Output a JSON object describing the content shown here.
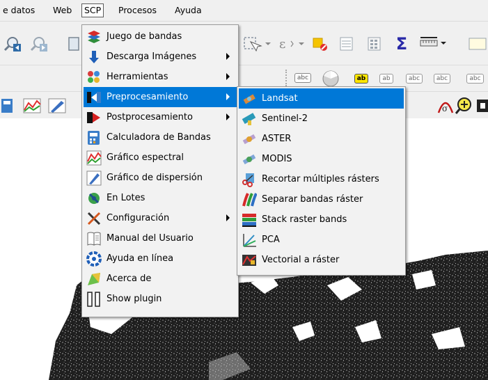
{
  "menubar": {
    "items": [
      "e datos",
      "Web",
      "SCP",
      "Procesos",
      "Ayuda"
    ]
  },
  "toolbar_text": {
    "abc": "abc",
    "ab": "ab",
    "sigma": "Σ"
  },
  "scp_menu": {
    "items": [
      {
        "label": "Juego de bandas",
        "icon": "band-set-icon",
        "submenu": false
      },
      {
        "label": "Descarga Imágenes",
        "icon": "download-icon",
        "submenu": true
      },
      {
        "label": "Herramientas",
        "icon": "tools-icon",
        "submenu": true
      },
      {
        "label": "Preprocesamiento",
        "icon": "preprocessing-icon",
        "submenu": true,
        "highlighted": true
      },
      {
        "label": "Postprocesamiento",
        "icon": "postprocessing-icon",
        "submenu": true
      },
      {
        "label": "Calculadora de Bandas",
        "icon": "band-calc-icon",
        "submenu": false
      },
      {
        "label": "Gráfico espectral",
        "icon": "spectral-plot-icon",
        "submenu": false
      },
      {
        "label": "Gráfico de dispersión",
        "icon": "scatter-plot-icon",
        "submenu": false
      },
      {
        "label": "En Lotes",
        "icon": "batch-icon",
        "submenu": false
      },
      {
        "label": "Configuración",
        "icon": "settings-icon",
        "submenu": true
      },
      {
        "label": "Manual del Usuario",
        "icon": "manual-icon",
        "submenu": false
      },
      {
        "label": "Ayuda en línea",
        "icon": "online-help-icon",
        "submenu": false
      },
      {
        "label": "Acerca de",
        "icon": "about-icon",
        "submenu": false
      },
      {
        "label": "Show plugin",
        "icon": "show-plugin-icon",
        "submenu": false
      }
    ]
  },
  "preprocessing_menu": {
    "items": [
      {
        "label": "Landsat",
        "icon": "landsat-icon",
        "highlighted": true
      },
      {
        "label": "Sentinel-2",
        "icon": "sentinel-icon"
      },
      {
        "label": "ASTER",
        "icon": "aster-icon"
      },
      {
        "label": "MODIS",
        "icon": "modis-icon"
      },
      {
        "label": "Recortar múltiples rásters",
        "icon": "clip-rasters-icon"
      },
      {
        "label": "Separar bandas ráster",
        "icon": "split-bands-icon"
      },
      {
        "label": "Stack raster bands",
        "icon": "stack-bands-icon"
      },
      {
        "label": "PCA",
        "icon": "pca-icon"
      },
      {
        "label": "Vectorial a ráster",
        "icon": "vector-to-raster-icon"
      }
    ]
  },
  "colors": {
    "highlight": "#0078d7",
    "menu_bg": "#f2f2f2",
    "toolbar_bg": "#f0f0f0"
  }
}
